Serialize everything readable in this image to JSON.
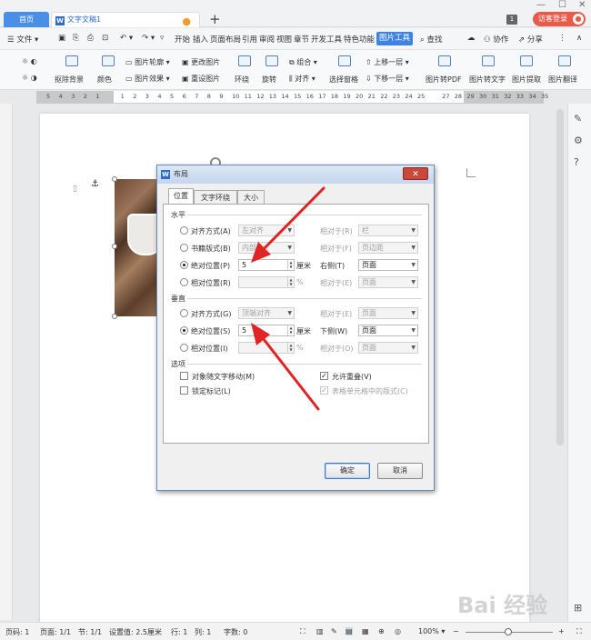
{
  "tabs": {
    "home": "首页",
    "doc": "文字文稿1",
    "add": "+"
  },
  "topright": {
    "page_count": "1",
    "visitor": "访客登录"
  },
  "menu": {
    "file": "文件",
    "items": [
      "开始",
      "插入",
      "页面布局",
      "引用",
      "审阅",
      "视图",
      "章节",
      "开发工具",
      "特色功能",
      "图片工具"
    ],
    "search": "查找",
    "collab": "协作",
    "share": "分享"
  },
  "ribbon": {
    "remove_bg": "抠除背景",
    "color": "颜色",
    "outline": "图片轮廓",
    "effect": "图片效果",
    "change_pic": "更改图片",
    "reset_pic": "重设图片",
    "wrap": "环绕",
    "rotate": "旋转",
    "group": "组合",
    "align": "对齐",
    "selection_pane": "选择窗格",
    "bring_forward": "上移一层",
    "send_backward": "下移一层",
    "to_pdf": "图片转PDF",
    "to_text": "图片转文字",
    "extract": "图片提取",
    "translate": "图片翻译"
  },
  "ruler": {
    "ticks": [
      "5",
      "4",
      "3",
      "2",
      "1",
      "",
      "1",
      "2",
      "3",
      "4",
      "5",
      "6",
      "7",
      "8",
      "9",
      "10",
      "11",
      "12",
      "13",
      "14",
      "15",
      "16",
      "17",
      "18",
      "19",
      "20",
      "21",
      "22",
      "23",
      "24",
      "25",
      "",
      "27",
      "28",
      "29",
      "30",
      "31",
      "32",
      "33",
      "34",
      "35"
    ]
  },
  "dialog": {
    "title": "布局",
    "close": "✕",
    "tabs": [
      "位置",
      "文字环绕",
      "大小"
    ],
    "horizontal": {
      "header": "水平",
      "align_label": "对齐方式(A)",
      "align_value": "左对齐",
      "book_label": "书籍版式(B)",
      "book_value": "内部",
      "abs_label": "绝对位置(P)",
      "abs_value": "5",
      "abs_unit": "厘米",
      "rel_label": "相对位置(R)",
      "rel_unit": "%",
      "relto_a": "相对于(R)",
      "relto_a_value": "栏",
      "relto_b": "相对于(F)",
      "relto_b_value": "页边距",
      "right_of": "右侧(T)",
      "right_of_value": "页面",
      "relto_e": "相对于(E)",
      "relto_e_value": "页面"
    },
    "vertical": {
      "header": "垂直",
      "align_label": "对齐方式(G)",
      "align_value": "顶端对齐",
      "abs_label": "绝对位置(S)",
      "abs_value": "5",
      "abs_unit": "厘米",
      "rel_label": "相对位置(I)",
      "rel_unit": "%",
      "relto_e": "相对于(E)",
      "relto_e_value": "页面",
      "below": "下侧(W)",
      "below_value": "页面",
      "relto_o": "相对于(O)",
      "relto_o_value": "页面"
    },
    "options": {
      "header": "选项",
      "move_with_text": "对象随文字移动(M)",
      "lock_anchor": "锁定标记(L)",
      "allow_overlap": "允许重叠(V)",
      "table_cell": "表格单元格中的版式(C)"
    },
    "ok": "确定",
    "cancel": "取消"
  },
  "status": {
    "page": "页码: 1",
    "pages": "页面: 1/1",
    "section": "节: 1/1",
    "setting": "设置值: 2.5厘米",
    "row": "行: 1",
    "col": "列: 1",
    "words": "字数: 0",
    "zoom": "100%"
  },
  "watermark": "Bai 经验"
}
